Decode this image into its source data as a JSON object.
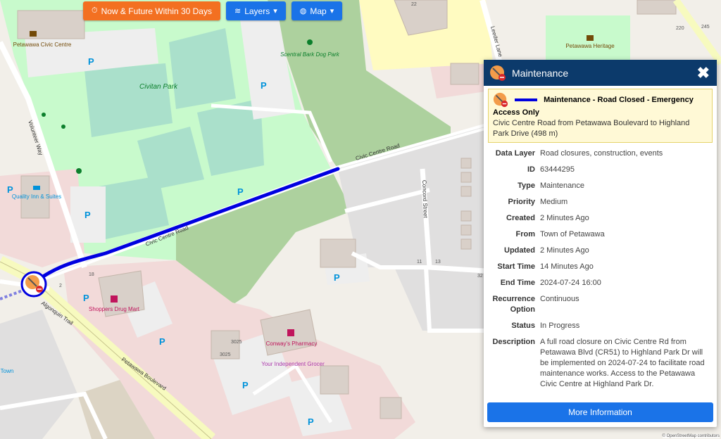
{
  "toolbar": {
    "filter_label": "Now & Future Within 30 Days",
    "filter_color": "#f37021",
    "layers_label": "Layers",
    "map_label": "Map",
    "button_color": "#1a73e8"
  },
  "map": {
    "place_labels": {
      "civic_centre": "Petawawa Civic Centre",
      "civitan_park": "Civitan Park",
      "dog_park": "Scentral Bark Dog Park",
      "heritage": "Petawawa Heritage",
      "quality_inn": "Quality Inn & Suites",
      "shoppers": "Shoppers Drug Mart",
      "conways": "Conway's Pharmacy",
      "grocer": "Your Independent Grocer",
      "town": "Town",
      "house_3025a": "3025",
      "house_3025b": "3025",
      "house_22": "22",
      "house_18": "18",
      "house_32": "32",
      "house_11": "11",
      "house_13": "13",
      "house_2": "2",
      "house_220": "220",
      "house_245": "245"
    },
    "street_labels": {
      "civic_centre_road": "Civic Centre Road",
      "civic_centre_road_west": "Civic Centre Road",
      "volunteer_way": "Volunteer Way",
      "concord_street": "Concord Street",
      "leeder_lane": "Leeder Lane",
      "algonquin_trail": "Algonquin Trail",
      "petawawa_boulevard": "Petawawa Boulevard"
    },
    "parking_label": "P",
    "closure_color": "#0000e0"
  },
  "popup": {
    "header_title": "Maintenance",
    "header_color": "#0c3a6b",
    "close_label": "✖",
    "summary_title": "Maintenance - Road Closed - Emergency Access Only",
    "summary_text": "Civic Centre Road from Petawawa Boulevard to Highland Park Drive (498 m)",
    "fields": [
      {
        "label": "Data Layer",
        "value": "Road closures, construction, events"
      },
      {
        "label": "ID",
        "value": "63444295"
      },
      {
        "label": "Type",
        "value": "Maintenance"
      },
      {
        "label": "Priority",
        "value": "Medium"
      },
      {
        "label": "Created",
        "value": "2 Minutes Ago"
      },
      {
        "label": "From",
        "value": "Town of Petawawa"
      },
      {
        "label": "Updated",
        "value": "2 Minutes Ago"
      },
      {
        "label": "Start Time",
        "value": "14 Minutes Ago"
      },
      {
        "label": "End Time",
        "value": "2024-07-24 16:00"
      },
      {
        "label": "Recurrence Option",
        "value": "Continuous"
      },
      {
        "label": "Status",
        "value": "In Progress"
      },
      {
        "label": "Description",
        "value": "A full road closure on Civic Centre Rd from Petawawa Blvd (CR51) to Highland Park Dr will be implemented on 2024-07-24 to facilitate road maintenance works. Access to the Petawawa Civic Centre at Highland Park Dr."
      }
    ],
    "more_label": "More Information"
  },
  "attribution": "© OpenStreetMap contributors"
}
